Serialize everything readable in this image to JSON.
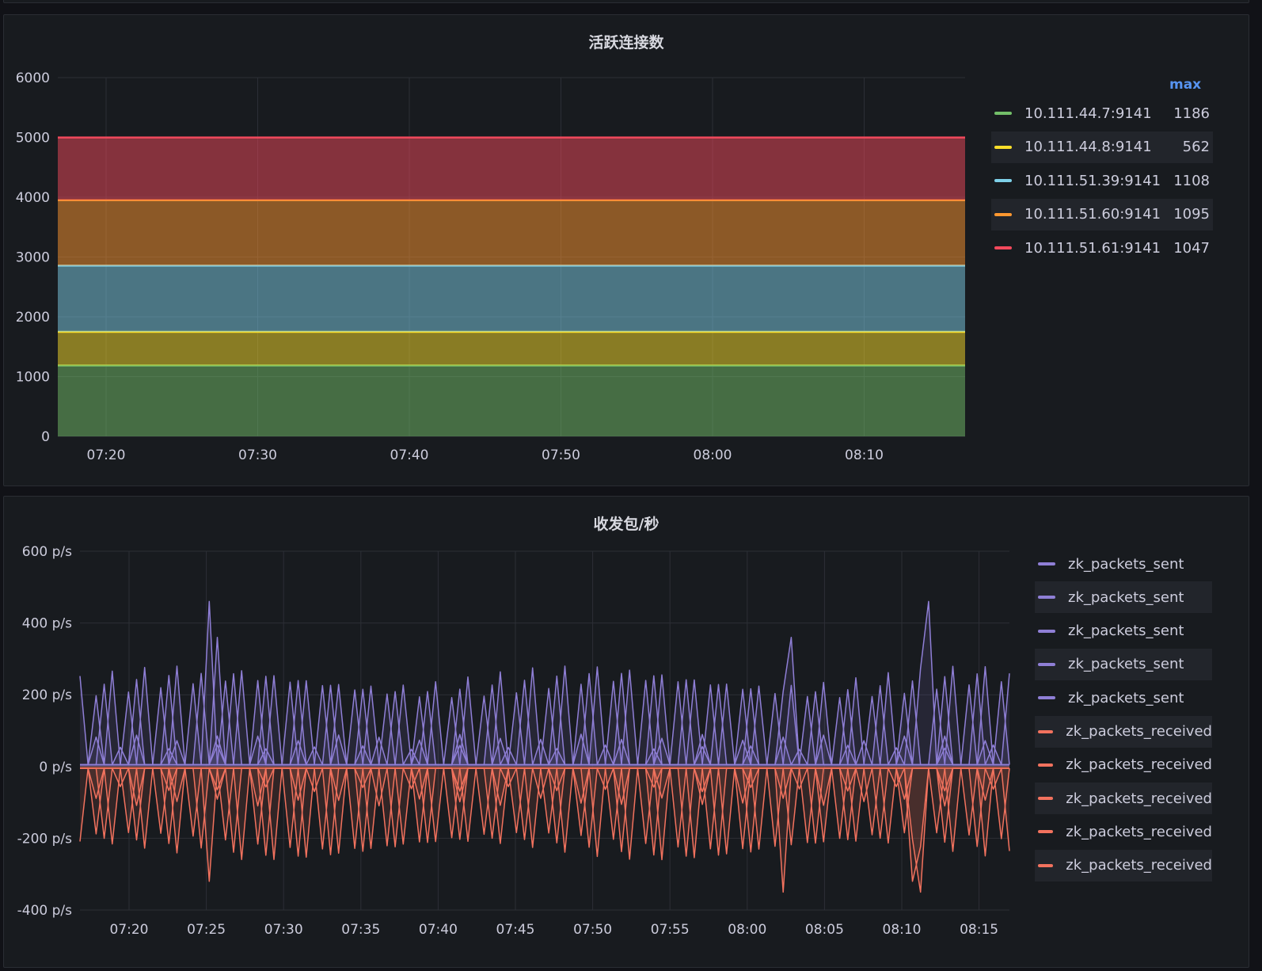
{
  "colors": {
    "green": "#73bf69",
    "yellow": "#fade2a",
    "blue": "#8ab8ff",
    "cyan": "#7ed0e8",
    "orange": "#ff9830",
    "red": "#f2495c",
    "purple": "#8f7fd6",
    "salmon": "#f2725e"
  },
  "chart_data": [
    {
      "type": "area",
      "title": "活跃连接数",
      "stacked": true,
      "ylim": [
        0,
        6000
      ],
      "yticks": [
        "0",
        "1000",
        "2000",
        "3000",
        "4000",
        "5000",
        "6000"
      ],
      "xticks": [
        "07:20",
        "07:30",
        "07:40",
        "07:50",
        "08:00",
        "08:10"
      ],
      "legend_header": "max",
      "legend_placement": "right",
      "series": [
        {
          "name": "10.111.44.7:9141",
          "max": "1186",
          "value": 1186,
          "color": "#73bf69"
        },
        {
          "name": "10.111.44.8:9141",
          "max": "562",
          "value": 562,
          "color": "#fade2a"
        },
        {
          "name": "10.111.51.39:9141",
          "max": "1108",
          "value": 1108,
          "color": "#7ed0e8"
        },
        {
          "name": "10.111.51.60:9141",
          "max": "1095",
          "value": 1095,
          "color": "#ff9830"
        },
        {
          "name": "10.111.51.61:9141",
          "max": "1047",
          "value": 1047,
          "color": "#f2495c"
        }
      ]
    },
    {
      "type": "line",
      "title": "收发包/秒",
      "ylim": [
        -400,
        600
      ],
      "yticks": [
        "-400 p/s",
        "-200 p/s",
        "0 p/s",
        "200 p/s",
        "400 p/s",
        "600 p/s"
      ],
      "xticks": [
        "07:20",
        "07:25",
        "07:30",
        "07:35",
        "07:40",
        "07:45",
        "07:50",
        "07:55",
        "08:00",
        "08:05",
        "08:10",
        "08:15"
      ],
      "legend_placement": "right",
      "series": [
        {
          "name": "zk_packets_sent",
          "color": "#8f7fd6",
          "direction": 1,
          "amplitude": 280,
          "phase": 0,
          "period": 4
        },
        {
          "name": "zk_packets_sent",
          "color": "#8f7fd6",
          "direction": 1,
          "amplitude": 260,
          "phase": 1,
          "period": 4
        },
        {
          "name": "zk_packets_sent",
          "color": "#8f7fd6",
          "direction": 1,
          "amplitude": 240,
          "phase": 2,
          "period": 4
        },
        {
          "name": "zk_packets_sent",
          "color": "#8f7fd6",
          "direction": 1,
          "amplitude": 90,
          "phase": 3,
          "period": 5
        },
        {
          "name": "zk_packets_sent",
          "color": "#8f7fd6",
          "direction": 1,
          "amplitude": 60,
          "phase": 1,
          "period": 6
        },
        {
          "name": "zk_packets_received",
          "color": "#f2725e",
          "direction": -1,
          "amplitude": 260,
          "phase": 0,
          "period": 4
        },
        {
          "name": "zk_packets_received",
          "color": "#f2725e",
          "direction": -1,
          "amplitude": 250,
          "phase": 1,
          "period": 4
        },
        {
          "name": "zk_packets_received",
          "color": "#f2725e",
          "direction": -1,
          "amplitude": 230,
          "phase": 2,
          "period": 4
        },
        {
          "name": "zk_packets_received",
          "color": "#f2725e",
          "direction": -1,
          "amplitude": 110,
          "phase": 3,
          "period": 5
        },
        {
          "name": "zk_packets_received",
          "color": "#f2725e",
          "direction": -1,
          "amplitude": 70,
          "phase": 1,
          "period": 6
        }
      ]
    }
  ]
}
